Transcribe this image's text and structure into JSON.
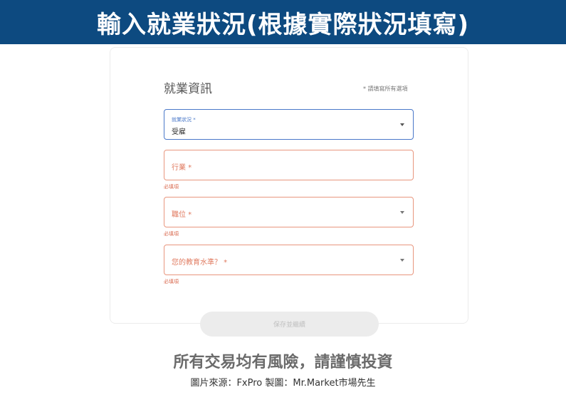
{
  "banner": {
    "title": "輸入就業狀況(根據實際狀況填寫)"
  },
  "form": {
    "section_title": "就業資訊",
    "required_note": "* 請填寫所有選項",
    "employment_status": {
      "label": "就業狀況 *",
      "value": "受雇"
    },
    "industry": {
      "label": "行業 *",
      "error": "必填項"
    },
    "position": {
      "label": "職位 *",
      "error": "必填項"
    },
    "education": {
      "label": "您的教育水準？ *",
      "error": "必填項"
    },
    "save_label": "保存並繼續"
  },
  "footer": {
    "risk_warning": "所有交易均有風險，請謹慎投資",
    "source_credit": "圖片來源：FxPro 製圖：Mr.Market市場先生"
  },
  "colors": {
    "banner": "#0d4a80",
    "focus": "#4a78c9",
    "error": "#e07a5f"
  }
}
